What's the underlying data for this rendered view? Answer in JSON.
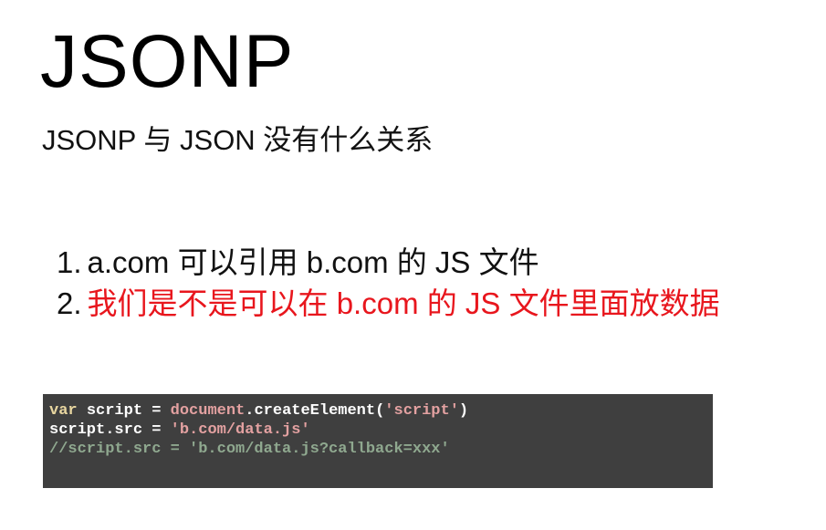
{
  "slide": {
    "title": "JSONP",
    "subtitle": "JSONP 与 JSON 没有什么关系"
  },
  "points": [
    {
      "number": "1.",
      "text": "a.com 可以引用 b.com 的 JS 文件"
    },
    {
      "number": "2.",
      "text": "我们是不是可以在 b.com 的 JS 文件里面放数据"
    }
  ],
  "colors": {
    "highlight": "#e8161d",
    "code_background": "#3f3f3f"
  },
  "code": {
    "line1": {
      "keyword": "var",
      "sp1": " ",
      "name": "script",
      "op": " = ",
      "builtin": "document",
      "call": ".createElement(",
      "string": "'script'",
      "close": ")"
    },
    "line2": {
      "lhs": "script.src",
      "op": " = ",
      "string": "'b.com/data.js'"
    },
    "line3": {
      "comment": "//script.src = 'b.com/data.js?callback=xxx'"
    }
  }
}
